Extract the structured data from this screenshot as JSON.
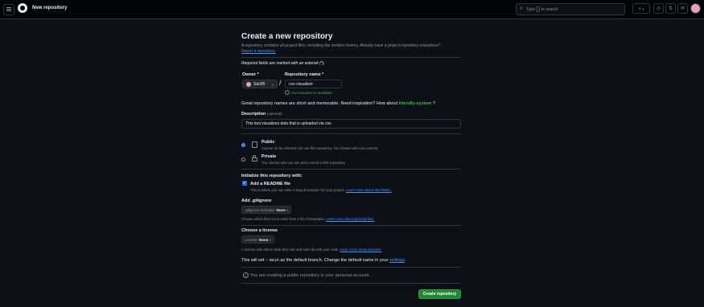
{
  "header": {
    "title": "New repository",
    "search_prefix": "Type",
    "search_key": "/",
    "search_suffix": "to search",
    "plus_label": "+",
    "plus_caret": "▾",
    "icons": [
      "menu-icon",
      "github-logo",
      "search-icon",
      "plus-icon",
      "issues-icon",
      "pull-requests-icon",
      "inbox-icon",
      "avatar"
    ]
  },
  "page": {
    "title": "Create a new repository",
    "subtitle": "A repository contains all project files, including the revision history. Already have a project repository elsewhere?",
    "import_link": "Import a repository.",
    "required_note": "Required fields are marked with an asterisk (*)."
  },
  "owner": {
    "label": "Owner *",
    "value": "Sari95"
  },
  "repo": {
    "label": "Repository name *",
    "value": "csv-visualizer",
    "availability": "csv-visualizer is available."
  },
  "inspiration": {
    "text": "Great repository names are short and memorable. Need inspiration? How about",
    "suggestion": "friendly-system",
    "suffix": "?"
  },
  "description": {
    "label": "Description",
    "optional": "(optional)",
    "value": "This tool visualizes data that is uploaded via csv."
  },
  "visibility": {
    "selected": "public",
    "public_title": "Public",
    "public_desc": "Anyone on the internet can see this repository. You choose who can commit.",
    "private_title": "Private",
    "private_desc": "You choose who can see and commit to this repository."
  },
  "init": {
    "heading": "Initialize this repository with:",
    "readme_label": "Add a README file",
    "readme_checked": true,
    "readme_desc": "This is where you can write a long description for your project.",
    "readme_link": "Learn more about READMEs."
  },
  "gitignore": {
    "heading": "Add .gitignore",
    "select_prefix": ".gitignore template:",
    "select_value": "None",
    "desc": "Choose which files not to track from a list of templates.",
    "link": "Learn more about ignoring files."
  },
  "license": {
    "heading": "Choose a license",
    "select_prefix": "License:",
    "select_value": "None",
    "desc": "A license tells others what they can and can't do with your code.",
    "link": "Learn more about licenses."
  },
  "branch": {
    "prefix": "This will set",
    "name": "main",
    "middle": "as the default branch. Change the default name in your",
    "link": "settings",
    "suffix": "."
  },
  "info": {
    "text": "You are creating a public repository in your personal account."
  },
  "actions": {
    "create_label": "Create repository"
  },
  "colors": {
    "background": "#0d1117",
    "primary_button": "#238636",
    "link": "#4493f8",
    "success": "#3fb950"
  }
}
